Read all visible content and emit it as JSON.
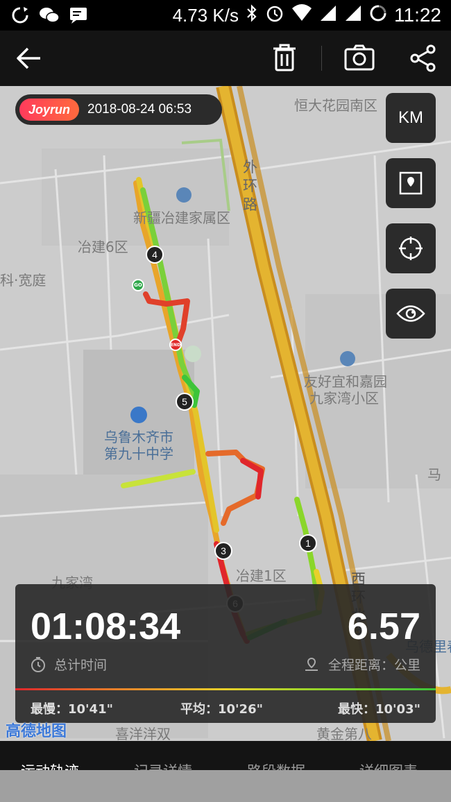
{
  "status_bar": {
    "speed": "4.73 K/s",
    "time": "11:22",
    "icons": [
      "sync-icon",
      "wechat-icon",
      "message-icon",
      "bluetooth-icon",
      "alarm-icon",
      "wifi-icon",
      "signal-icon",
      "signal-icon",
      "battery-icon"
    ]
  },
  "appbar": {
    "icons": [
      "back-arrow-icon",
      "trash-icon",
      "camera-icon",
      "share-icon"
    ]
  },
  "map": {
    "brand": "Joyrun",
    "datetime": "2018-08-24 06:53",
    "unit_button": "KM",
    "side_icons": [
      "map-pin-icon",
      "crosshair-icon",
      "eye-icon"
    ],
    "labels": {
      "hengda": "恒大花园南区",
      "waihuan": "外环路",
      "xinjiang": "新疆冶建家属区",
      "yejian6": "冶建6区",
      "kuanting": "科·宽庭",
      "youhaoyi": "友好宜和嘉园",
      "jiujiawan_xq": "九家湾小区",
      "school1": "乌鲁木齐市",
      "school2": "第九十中学",
      "ma": "马",
      "jiujiawan": "九家湾",
      "yejian1": "冶建1区",
      "xihuan": "西环北路",
      "wudeli": "乌德里春",
      "xiyang": "喜洋洋双",
      "huangjin": "黄金第八",
      "gaode": "高德地图"
    },
    "markers": [
      "1",
      "3",
      "4",
      "5",
      "6"
    ],
    "go_label": "GO",
    "end_label": "END"
  },
  "stats": {
    "duration": "01:08:34",
    "duration_label": "总计时间",
    "distance": "6.57",
    "distance_label": "全程距离：公里",
    "slowest": "最慢：10'41\"",
    "average": "平均：10'26\"",
    "fastest": "最快：10'03\""
  },
  "tabs": [
    "运动轨迹",
    "记录详情",
    "路段数据",
    "详细图表"
  ],
  "colors": {
    "accent": "#ff3b5c",
    "route_slow": "#e0262b",
    "route_fast": "#3ac43a",
    "road": "#d9a72a"
  }
}
